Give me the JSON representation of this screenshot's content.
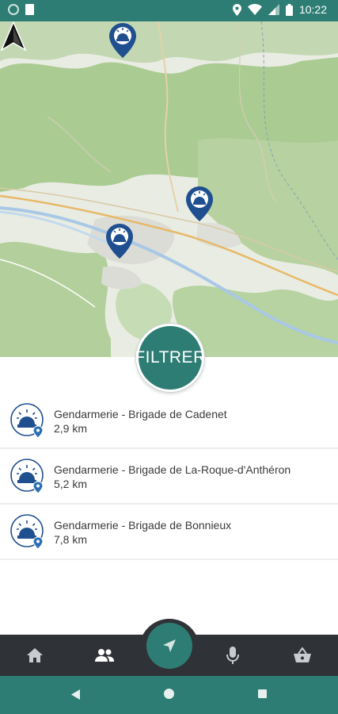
{
  "status_bar": {
    "time": "10:22"
  },
  "map": {
    "markers_icon": "gendarmerie-pin-icon",
    "position_icon": "navigation-arrow-icon"
  },
  "filter_button": {
    "label": "FILTRER"
  },
  "results": [
    {
      "name": "Gendarmerie - Brigade de Cadenet",
      "distance": "2,9 km"
    },
    {
      "name": "Gendarmerie - Brigade de La-Roque-d'Anthéron",
      "distance": "5,2 km"
    },
    {
      "name": "Gendarmerie - Brigade de Bonnieux",
      "distance": "7,8 km"
    }
  ],
  "bottom_nav": {
    "items": [
      "home-icon",
      "people-icon",
      "navigation-icon",
      "microphone-icon",
      "basket-icon"
    ]
  },
  "colors": {
    "primary": "#2e7d74",
    "nav_dark": "#2f3236",
    "pin": "#1f4f8f"
  }
}
